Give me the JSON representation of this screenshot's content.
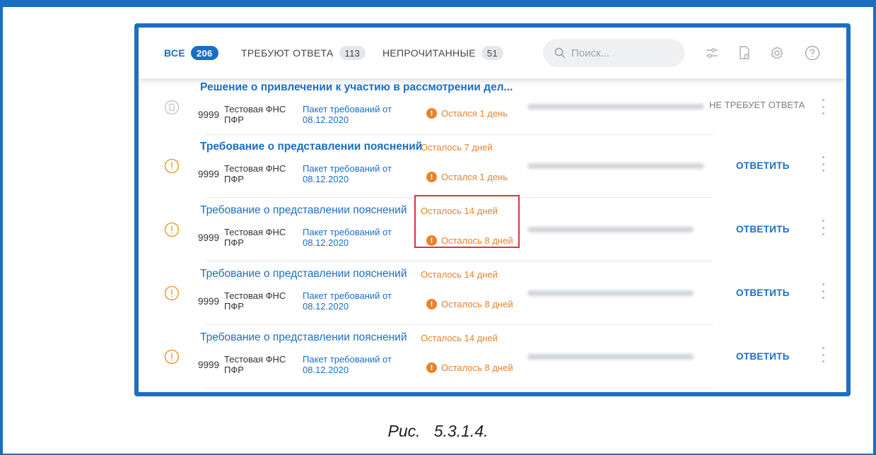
{
  "tabs": [
    {
      "label": "Все",
      "count": "206"
    },
    {
      "label": "Требуют ответа",
      "count": "113"
    },
    {
      "label": "Непрочитанные",
      "count": "51"
    }
  ],
  "search": {
    "placeholder": "Поиск..."
  },
  "icons": {
    "filter": "sliders-icon",
    "document": "document-clock-icon",
    "settings": "gear-icon",
    "help": "help-icon",
    "row_doc": "document-icon",
    "row_alert": "alert-circle-icon"
  },
  "colors": {
    "accent": "#1a6fc4",
    "warning": "#e8822a",
    "highlight": "#e0323a"
  },
  "rows": [
    {
      "title": "Решение о привлечении к участию в рассмотрении дел...",
      "deadline_top": "",
      "number": "9999",
      "sender": "Тестовая ФНС ПФР",
      "package": "Пакет требований от 08.12.2020",
      "deadline": "Остался 1 день",
      "status": "НЕ ТРЕБУЕТ ОТВЕТА",
      "action": ""
    },
    {
      "title": "Требование о представлении пояснений",
      "deadline_top": "Осталось 7 дней",
      "number": "9999",
      "sender": "Тестовая ФНС ПФР",
      "package": "Пакет требований от 08.12.2020",
      "deadline": "Остался 1 день",
      "status": "",
      "action": "ОТВЕТИТЬ"
    },
    {
      "title": "Требование о представлении пояснений",
      "deadline_top": "Осталось 14 дней",
      "number": "9999",
      "sender": "Тестовая ФНС ПФР",
      "package": "Пакет требований от 08.12.2020",
      "deadline": "Осталось 8 дней",
      "status": "",
      "action": "ОТВЕТИТЬ"
    },
    {
      "title": "Требование о представлении пояснений",
      "deadline_top": "Осталось 14 дней",
      "number": "9999",
      "sender": "Тестовая ФНС ПФР",
      "package": "Пакет требований от 08.12.2020",
      "deadline": "Осталось 8 дней",
      "status": "",
      "action": "ОТВЕТИТЬ"
    },
    {
      "title": "Требование о представлении пояснений",
      "deadline_top": "Осталось 14 дней",
      "number": "9999",
      "sender": "Тестовая ФНС ПФР",
      "package": "Пакет требований от 08.12.2020",
      "deadline": "Осталось 8 дней",
      "status": "",
      "action": "ОТВЕТИТЬ"
    }
  ],
  "caption": {
    "prefix": "Рис.",
    "number": "5.3.1.4."
  }
}
